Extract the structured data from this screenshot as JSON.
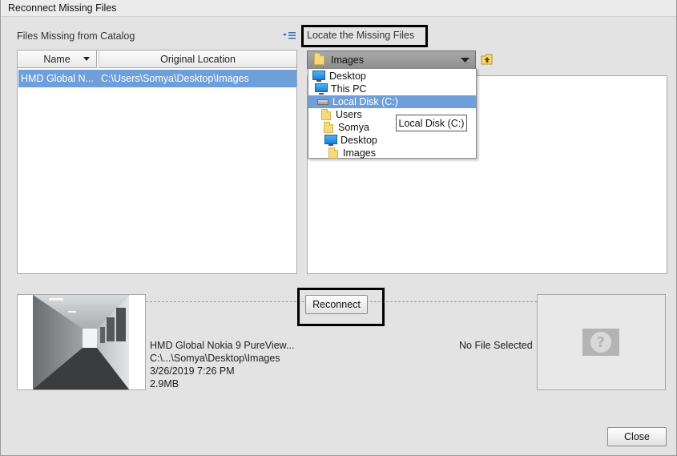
{
  "window": {
    "title": "Reconnect Missing Files"
  },
  "left_panel": {
    "label": "Files Missing from Catalog",
    "options_icon": "list-options-icon",
    "columns": [
      "Name",
      "Original Location"
    ],
    "rows": [
      {
        "name": "HMD Global N...",
        "location": "C:\\Users\\Somya\\Desktop\\Images",
        "selected": true
      }
    ]
  },
  "right_panel": {
    "tab_label": "Locate the Missing Files",
    "folder_dropdown": {
      "value": "Images",
      "icon": "folder-icon"
    },
    "up_folder_icon": "folder-up-icon",
    "tree": [
      {
        "label": "Desktop",
        "icon": "monitor-icon"
      },
      {
        "label": "This PC",
        "icon": "computer-icon"
      },
      {
        "label": "Local Disk (C:)",
        "icon": "disk-icon",
        "selected": true
      },
      {
        "label": "Users",
        "icon": "folder-icon"
      },
      {
        "label": "Somya",
        "icon": "folder-icon"
      },
      {
        "label": "Desktop",
        "icon": "monitor-icon"
      },
      {
        "label": "Images",
        "icon": "folder-icon"
      }
    ],
    "tooltip": "Local Disk (C:)"
  },
  "preview": {
    "reconnect_label": "Reconnect",
    "file_info": [
      "HMD Global Nokia 9 PureView...",
      "C:\\...\\Somya\\Desktop\\Images",
      "3/26/2019 7:26 PM",
      "2.9MB"
    ],
    "no_file_text": "No File Selected",
    "placeholder_icon": "question-mark-icon"
  },
  "footer": {
    "close_label": "Close"
  },
  "colors": {
    "selection": "#6e9fda",
    "highlight_border": "#000000"
  }
}
